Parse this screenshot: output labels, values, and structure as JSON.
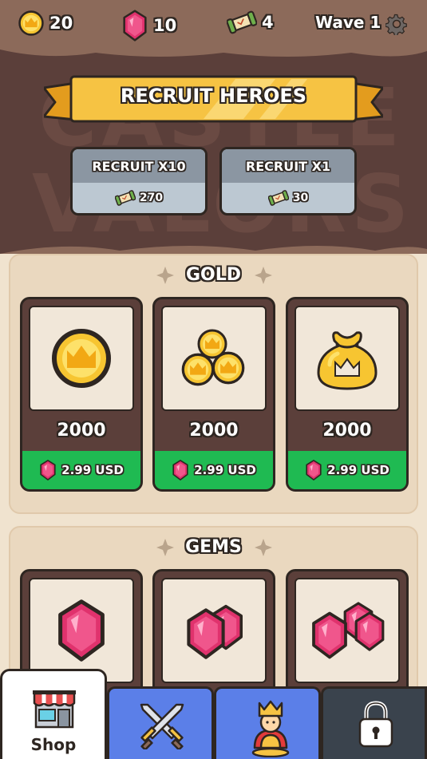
{
  "resources": {
    "gold": "20",
    "gems": "10",
    "tickets": "4",
    "wave": "Wave 1"
  },
  "recruit": {
    "title": "RECRUIT HEROES",
    "buttons": [
      {
        "label": "RECRUIT X10",
        "cost": "270"
      },
      {
        "label": "RECRUIT X1",
        "cost": "30"
      }
    ]
  },
  "gold_section": {
    "title": "GOLD",
    "items": [
      {
        "amount": "2000",
        "price": "2.99 USD"
      },
      {
        "amount": "2000",
        "price": "2.99 USD"
      },
      {
        "amount": "2000",
        "price": "2.99 USD"
      }
    ]
  },
  "gems_section": {
    "title": "GEMS"
  },
  "nav": {
    "shop_label": "Shop"
  },
  "colors": {
    "gold": "#f7c531",
    "gem": "#e0326d",
    "price_green": "#1fba52",
    "nav_blue": "#5b7fe8",
    "nav_dark": "#3a434d"
  }
}
